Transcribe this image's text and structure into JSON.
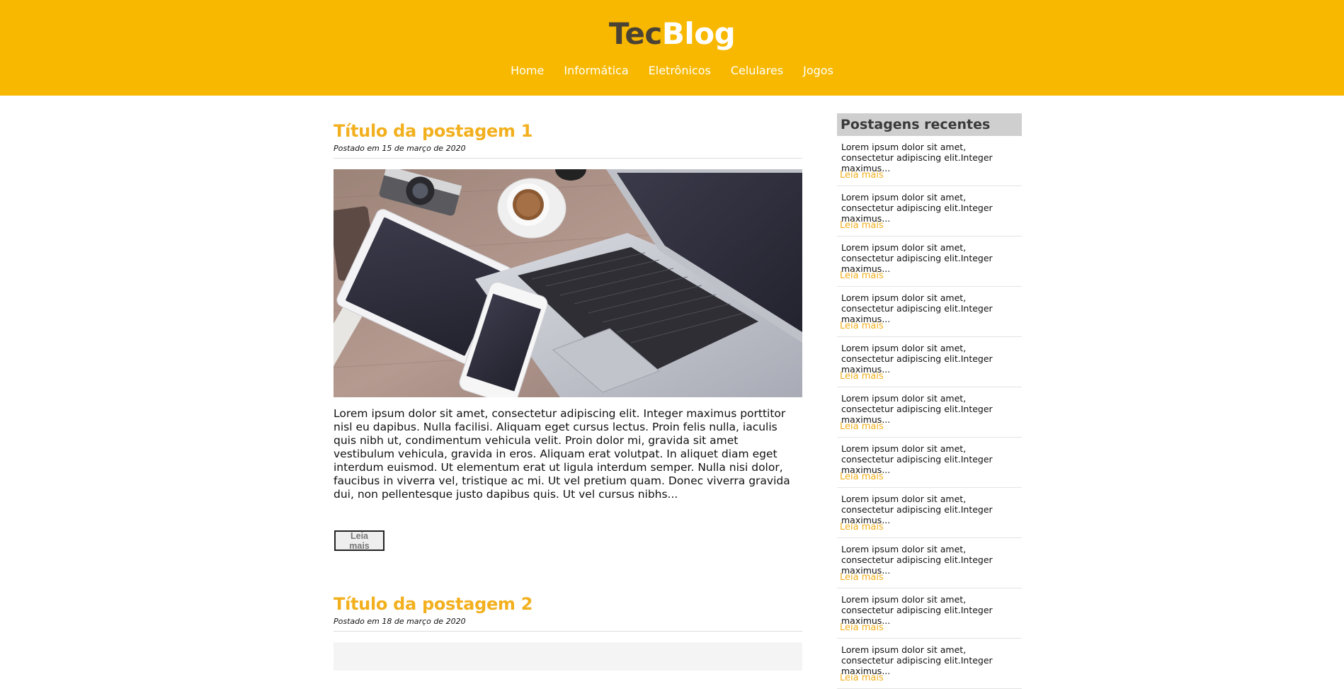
{
  "header": {
    "logo_part1": "Tec",
    "logo_part2": "Blog",
    "nav": [
      "Home",
      "Informática",
      "Eletrônicos",
      "Celulares",
      "Jogos"
    ]
  },
  "posts": [
    {
      "title": "Título da postagem 1",
      "date": "Postado em 15 de março de 2020",
      "excerpt": "Lorem ipsum dolor sit amet, consectetur adipiscing elit. Integer maximus porttitor nisl eu dapibus. Nulla facilisi. Aliquam eget cursus lectus. Proin felis nulla, iaculis quis nibh ut, condimentum vehicula velit. Proin dolor mi, gravida sit amet vestibulum vehicula, gravida in eros. Aliquam erat volutpat. In aliquet diam eget interdum euismod. Ut elementum erat ut ligula interdum semper. Nulla nisi dolor, faucibus in viverra vel, tristique ac mi. Ut vel pretium quam. Donec viverra gravida dui, non pellentesque justo dapibus quis. Ut vel cursus nibhs...",
      "button": "Leia mais"
    },
    {
      "title": "Título da postagem 2",
      "date": "Postado em 18 de março de 2020"
    }
  ],
  "sidebar": {
    "title": "Postagens recentes",
    "items": [
      {
        "excerpt": "Lorem ipsum dolor sit amet, consectetur adipiscing elit.Integer maximus...",
        "link": "Leia mais"
      },
      {
        "excerpt": "Lorem ipsum dolor sit amet, consectetur adipiscing elit.Integer maximus...",
        "link": "Leia mais"
      },
      {
        "excerpt": "Lorem ipsum dolor sit amet, consectetur adipiscing elit.Integer maximus...",
        "link": "Leia mais"
      },
      {
        "excerpt": "Lorem ipsum dolor sit amet, consectetur adipiscing elit.Integer maximus...",
        "link": "Leia mais"
      },
      {
        "excerpt": "Lorem ipsum dolor sit amet, consectetur adipiscing elit.Integer maximus...",
        "link": "Leia mais"
      },
      {
        "excerpt": "Lorem ipsum dolor sit amet, consectetur adipiscing elit.Integer maximus...",
        "link": "Leia mais"
      },
      {
        "excerpt": "Lorem ipsum dolor sit amet, consectetur adipiscing elit.Integer maximus...",
        "link": "Leia mais"
      },
      {
        "excerpt": "Lorem ipsum dolor sit amet, consectetur adipiscing elit.Integer maximus...",
        "link": "Leia mais"
      },
      {
        "excerpt": "Lorem ipsum dolor sit amet, consectetur adipiscing elit.Integer maximus...",
        "link": "Leia mais"
      },
      {
        "excerpt": "Lorem ipsum dolor sit amet, consectetur adipiscing elit.Integer maximus...",
        "link": "Leia mais"
      },
      {
        "excerpt": "Lorem ipsum dolor sit amet, consectetur adipiscing elit.Integer maximus...",
        "link": "Leia mais"
      }
    ]
  },
  "colors": {
    "brand": "#f8b800",
    "accent_text": "#f2b01e",
    "logo_dark": "#4a4235"
  }
}
